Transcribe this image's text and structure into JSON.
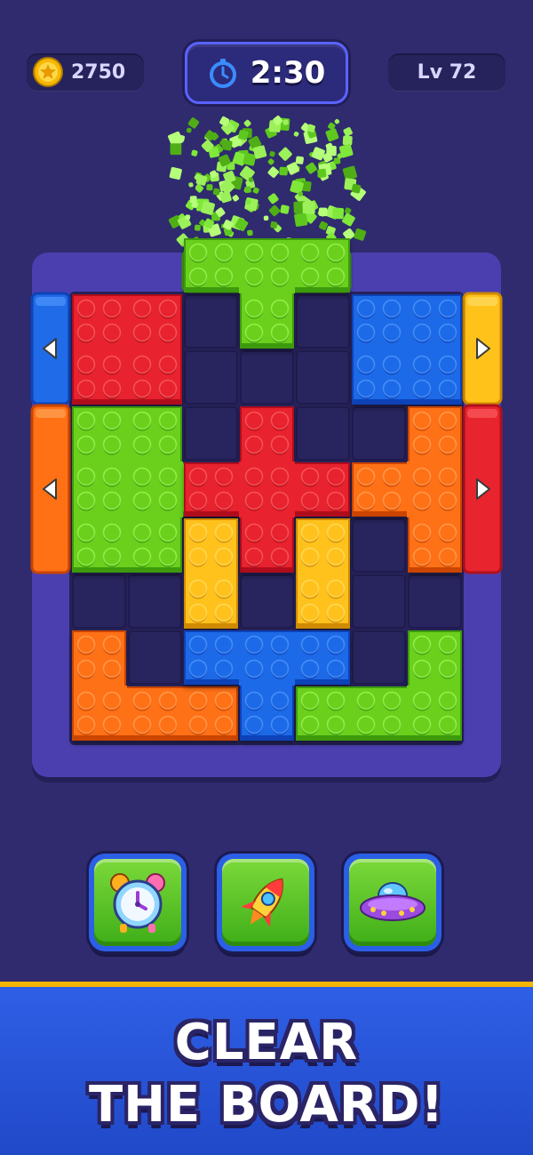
{
  "hud": {
    "coins": "2750",
    "timer": "2:30",
    "level": "Lv 72",
    "coin_icon": "star-coin-icon",
    "timer_icon": "stopwatch-icon"
  },
  "board": {
    "grid_size": [
      6,
      8
    ],
    "frame_color": "#4b3fb0",
    "cell_color": "#262259",
    "pieces": [
      {
        "name": "red-square-piece",
        "color": "red",
        "cells": [
          [
            0,
            0
          ],
          [
            1,
            0
          ],
          [
            0,
            1
          ],
          [
            1,
            1
          ]
        ]
      },
      {
        "name": "green-t-piece",
        "color": "green",
        "cells": [
          [
            2,
            -1
          ],
          [
            3,
            -1
          ],
          [
            4,
            -1
          ],
          [
            3,
            0
          ]
        ]
      },
      {
        "name": "blue-square-piece",
        "color": "blue",
        "cells": [
          [
            5,
            0
          ],
          [
            6,
            0
          ],
          [
            5,
            1
          ],
          [
            6,
            1
          ]
        ]
      },
      {
        "name": "green-h-piece",
        "color": "green",
        "cells": [
          [
            0,
            2
          ],
          [
            1,
            2
          ],
          [
            0,
            3
          ],
          [
            1,
            3
          ],
          [
            2,
            3
          ],
          [
            0,
            4
          ],
          [
            1,
            4
          ]
        ]
      },
      {
        "name": "red-cross-piece",
        "color": "red",
        "cells": [
          [
            3,
            2
          ],
          [
            2,
            3
          ],
          [
            3,
            3
          ],
          [
            4,
            3
          ],
          [
            3,
            4
          ]
        ]
      },
      {
        "name": "orange-h-piece",
        "color": "orange",
        "cells": [
          [
            6,
            2
          ],
          [
            5,
            3
          ],
          [
            6,
            3
          ],
          [
            6,
            4
          ]
        ]
      },
      {
        "name": "yellow-left-bar",
        "color": "yellow",
        "cells": [
          [
            2,
            4
          ],
          [
            2,
            5
          ]
        ]
      },
      {
        "name": "yellow-right-bar",
        "color": "yellow",
        "cells": [
          [
            4,
            4
          ],
          [
            4,
            5
          ]
        ]
      },
      {
        "name": "orange-l-piece",
        "color": "orange",
        "cells": [
          [
            0,
            6
          ],
          [
            0,
            7
          ],
          [
            1,
            7
          ],
          [
            2,
            7
          ]
        ]
      },
      {
        "name": "blue-t-piece",
        "color": "blue",
        "cells": [
          [
            2,
            6
          ],
          [
            3,
            6
          ],
          [
            4,
            6
          ],
          [
            3,
            7
          ]
        ]
      },
      {
        "name": "green-j-piece",
        "color": "green",
        "cells": [
          [
            6,
            6
          ],
          [
            4,
            7
          ],
          [
            5,
            7
          ],
          [
            6,
            7
          ]
        ]
      }
    ],
    "exits": [
      {
        "name": "blue-exit-gate-left",
        "side": "left",
        "color": "blue",
        "arrow": "left-arrow-icon"
      },
      {
        "name": "orange-exit-gate-left",
        "side": "left",
        "color": "orange",
        "arrow": "left-arrow-icon"
      },
      {
        "name": "yellow-exit-gate-right",
        "side": "right",
        "color": "yellow",
        "arrow": "right-arrow-icon"
      },
      {
        "name": "red-exit-gate-right",
        "side": "right",
        "color": "red",
        "arrow": "right-arrow-icon"
      },
      {
        "name": "green-exit-gate-top",
        "side": "top",
        "color": "green",
        "arrow": "up-arrow-icon"
      }
    ]
  },
  "boosters": [
    {
      "name": "alarm-clock-booster",
      "icon": "alarm-clock-icon"
    },
    {
      "name": "rocket-booster",
      "icon": "rocket-icon"
    },
    {
      "name": "ufo-booster",
      "icon": "ufo-icon"
    }
  ],
  "banner": {
    "line1": "CLEAR",
    "line2": "THE BOARD!"
  },
  "colors": {
    "red": "#e8242f",
    "green": "#6bd01f",
    "blue": "#1f6be8",
    "orange": "#ff7114",
    "yellow": "#ffc21a",
    "banner_accent": "#f5b400"
  }
}
